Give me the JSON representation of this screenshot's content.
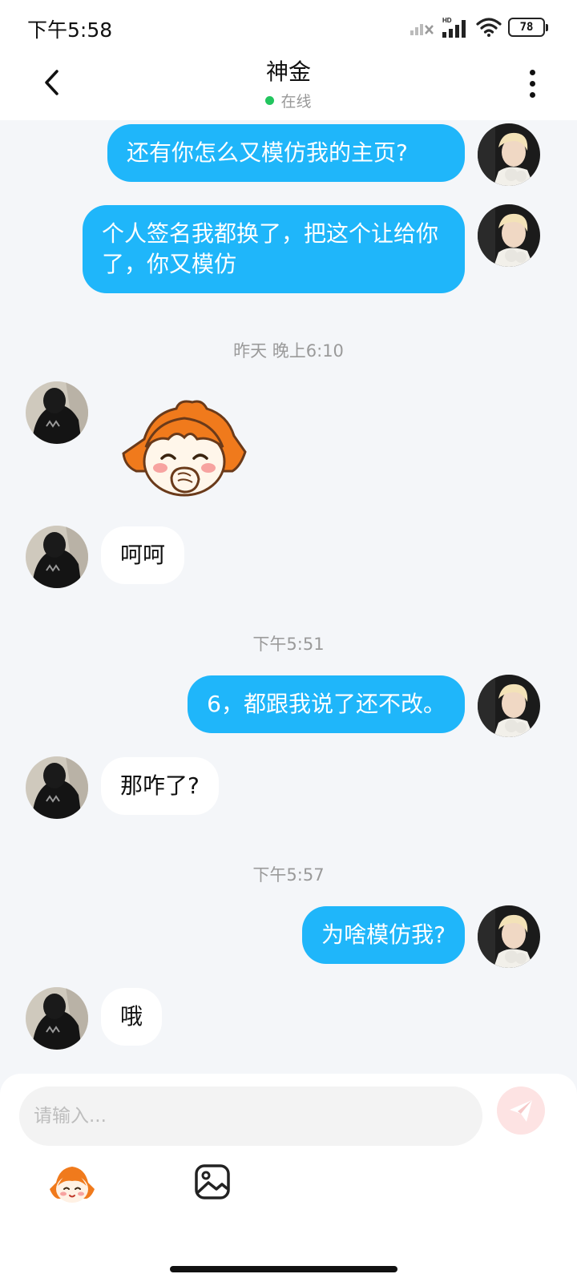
{
  "status_bar": {
    "time": "下午5:58",
    "network_label": "HD",
    "battery": "78"
  },
  "header": {
    "title": "神金",
    "status": "在线"
  },
  "messages": [
    {
      "direction": "out",
      "type": "text",
      "text": "还有你怎么又模仿我的主页?"
    },
    {
      "direction": "out",
      "type": "text",
      "text": "个人签名我都换了，把这个让给你了，你又模仿"
    },
    {
      "type": "timestamp",
      "text": "昨天 晚上6:10"
    },
    {
      "direction": "in",
      "type": "sticker",
      "icon": "laughing-girl-sticker"
    },
    {
      "direction": "in",
      "type": "text",
      "text": "呵呵"
    },
    {
      "type": "timestamp",
      "text": "下午5:51"
    },
    {
      "direction": "out",
      "type": "text",
      "text": "6，都跟我说了还不改。"
    },
    {
      "direction": "in",
      "type": "text",
      "text": "那咋了?"
    },
    {
      "type": "timestamp",
      "text": "下午5:57"
    },
    {
      "direction": "out",
      "type": "text",
      "text": "为啥模仿我?"
    },
    {
      "direction": "in",
      "type": "text",
      "text": "哦"
    }
  ],
  "composer": {
    "placeholder": "请输入...",
    "send_icon": "paper-plane-icon",
    "tools": [
      {
        "icon": "sticker-icon"
      },
      {
        "icon": "image-icon"
      }
    ]
  },
  "colors": {
    "outgoing_bubble": "#1fb6fa",
    "incoming_bubble": "#ffffff",
    "chat_background": "#f4f6f9",
    "online": "#22c55e",
    "send_button": "#fde3e3"
  }
}
